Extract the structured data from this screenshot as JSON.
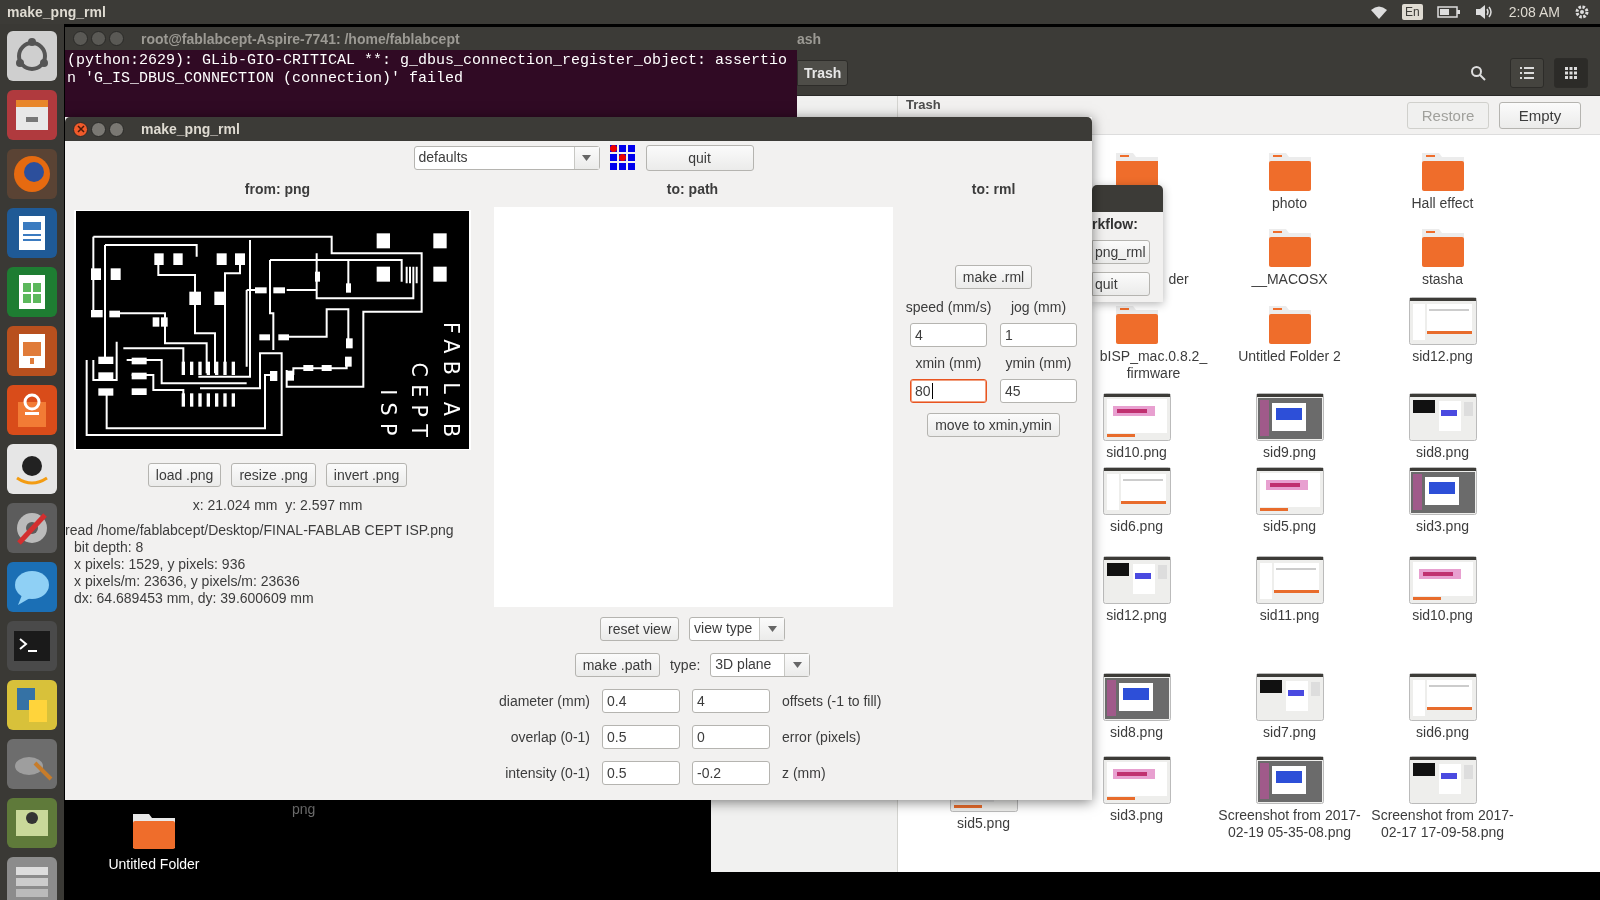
{
  "top_bar": {
    "title": "make_png_rml",
    "keyboard": "En",
    "clock": "2:08 AM"
  },
  "desktop": {
    "icons": [
      {
        "label": "Untitled Folder",
        "kind": "folder"
      },
      {
        "label": "png",
        "kind": "covered"
      }
    ]
  },
  "terminal": {
    "title": "root@fablabcept-Aspire-7741: /home/fablabcept",
    "blocks": [
      [
        "(python:2629): GLib-GIO-CRITICAL **: g_dbus_connection_register_object: assertio",
        "n 'G_IS_DBUS_CONNECTION (connection)' failed"
      ]
    ]
  },
  "file_manager": {
    "title": "ash",
    "path_button": "Trash",
    "view_buttons": [
      {
        "kind": "list",
        "selected": false
      },
      {
        "kind": "grid",
        "selected": true
      }
    ],
    "location": "Trash",
    "actions": [
      {
        "label": "Restore",
        "disabled": true
      },
      {
        "label": "Empty",
        "disabled": false
      }
    ],
    "rows": [
      [
        "",
        {
          "kind": "folder_top"
        },
        {
          "kind": "folder",
          "label": "photo"
        },
        {
          "kind": "folder",
          "label": "Hall effect"
        }
      ],
      [
        "",
        {
          "kind": "clipped",
          "label": "der"
        },
        {
          "kind": "folder",
          "label": "__MACOSX"
        },
        {
          "kind": "folder",
          "label": "stasha"
        }
      ],
      [
        "",
        {
          "kind": "folder",
          "label": "bISP_mac.0.8.2_ firmware"
        },
        {
          "kind": "folder",
          "label": "Untitled Folder 2"
        },
        {
          "kind": "picture",
          "label": "sid12.png"
        }
      ],
      [
        "",
        {
          "kind": "picture",
          "label": "sid10.png"
        },
        {
          "kind": "picture",
          "label": "sid9.png"
        },
        {
          "kind": "picture",
          "label": "sid8.png"
        }
      ],
      [
        "",
        {
          "kind": "picture",
          "label": "sid6.png"
        },
        {
          "kind": "picture",
          "label": "sid5.png"
        },
        {
          "kind": "picture",
          "label": "sid3.png"
        }
      ],
      [
        "",
        {
          "kind": "picture",
          "label": "sid12.png"
        },
        {
          "kind": "picture",
          "label": "sid11.png"
        },
        {
          "kind": "picture",
          "label": "sid10.png"
        }
      ],
      [
        "",
        {
          "kind": "picture",
          "label": "sid8.png"
        },
        {
          "kind": "picture",
          "label": "sid7.png"
        },
        {
          "kind": "picture",
          "label": "sid6.png"
        }
      ],
      [
        {
          "kind": "picture_strip",
          "label": "sid5.png"
        },
        {
          "kind": "picture",
          "label": "sid3.png"
        },
        {
          "kind": "picture",
          "label": "Screenshot from 2017-02-19 05-35-08.png"
        },
        {
          "kind": "picture",
          "label": "Screenshot from 2017-02-17 17-09-58.png"
        }
      ]
    ]
  },
  "workflow_window": {
    "heading": "rkflow:",
    "buttons": [
      "png_rml",
      "quit"
    ]
  },
  "app": {
    "title": "make_png_rml",
    "preset": "defaults",
    "quit": "quit",
    "from": {
      "heading": "from: png",
      "board_labels": [
        "FABLAB",
        "CEPT",
        "ISP"
      ],
      "buttons": [
        "load .png",
        "resize .png",
        "invert .png"
      ],
      "coords": "x: 21.024 mm  y: 2.597 mm",
      "read_line": "read /home/fablabcept/Desktop/FINAL-FABLAB CEPT ISP.png",
      "details": [
        "bit depth: 8",
        "x pixels: 1529, y pixels: 936",
        "x pixels/m: 23636, y pixels/m: 23636",
        "dx: 64.689453 mm, dy: 39.600609 mm"
      ]
    },
    "path": {
      "heading": "to: path",
      "reset": "reset view",
      "view_type": "view type",
      "make": "make .path",
      "type_label": "type:",
      "type_value": "3D plane",
      "params": [
        {
          "label": "diameter (mm)",
          "value": "0.4",
          "value2": "4",
          "label2": "offsets (-1 to fill)"
        },
        {
          "label": "overlap (0-1)",
          "value": "0.5",
          "value2": "0",
          "label2": "error (pixels)"
        },
        {
          "label": "intensity (0-1)",
          "value": "0.5",
          "value2": "-0.2",
          "label2": "z (mm)"
        }
      ]
    },
    "rml": {
      "heading": "to: rml",
      "make": "make .rml",
      "fields": [
        {
          "label": "speed (mm/s)",
          "value": "4",
          "focused": false
        },
        {
          "label": "jog (mm)",
          "value": "1",
          "focused": false
        },
        {
          "label": "xmin (mm)",
          "value": "80",
          "focused": true
        },
        {
          "label": "ymin (mm)",
          "value": "45",
          "focused": false
        }
      ],
      "move": "move to xmin,ymin"
    }
  }
}
